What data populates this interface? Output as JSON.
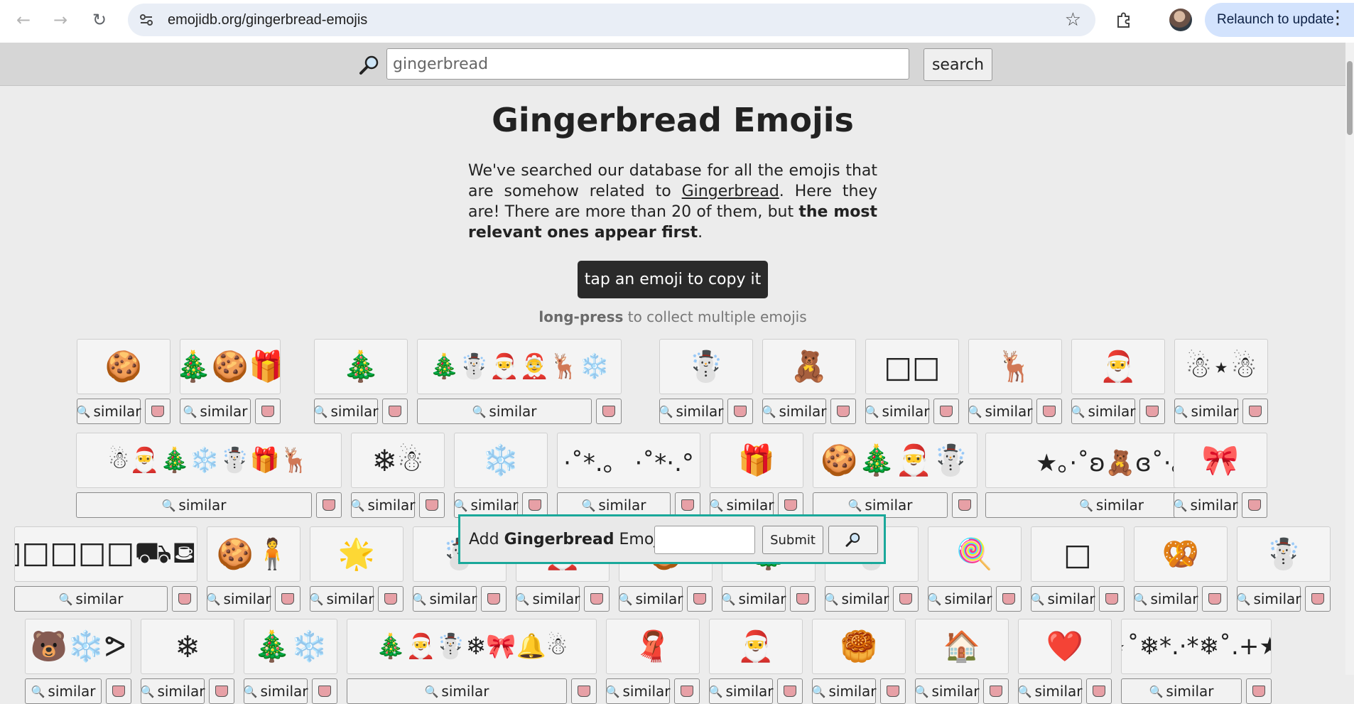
{
  "browser": {
    "back_icon": "←",
    "forward_icon": "→",
    "reload_icon": "↻",
    "url": "emojidb.org/gingerbread-emojis",
    "bookmark_icon": "☆",
    "extensions_icon": "⧉",
    "relaunch_label": "Relaunch to update",
    "menu_icon": "⋮"
  },
  "search": {
    "query": "gingerbread",
    "button_label": "search"
  },
  "page": {
    "title": "Gingerbread Emojis",
    "intro_pre": "We've searched our database for all the emojis that are somehow related to ",
    "intro_link": "Gingerbread",
    "intro_mid": ". Here they are! There are more than 20 of them, but ",
    "intro_bold": "the most relevant ones appear first",
    "intro_end": ".",
    "copy_hint": "tap an emoji to copy it",
    "long_press_bold": "long-press",
    "long_press_rest": " to collect multiple emojis"
  },
  "card_labels": {
    "similar": "similar",
    "similar_icon": "🔍"
  },
  "emoji_cards": [
    {
      "emoji": "🍪"
    },
    {
      "emoji": "🎄🍪🎁"
    },
    {
      "emoji": "🎄"
    },
    {
      "emoji": "🎄☃️🎅🤶🦌❄️"
    },
    {
      "emoji": "☃️"
    },
    {
      "emoji": "🧸"
    },
    {
      "emoji": "□□"
    },
    {
      "emoji": "🦌"
    },
    {
      "emoji": "🎅"
    },
    {
      "emoji": "☃⋆☃"
    },
    {
      "emoji": "☃🎅🎄❄️☃️🎁🦌"
    },
    {
      "emoji": "❄☃"
    },
    {
      "emoji": "❄️"
    },
    {
      "emoji": "·˚*.。 ·˚*·.°"
    },
    {
      "emoji": "🎁"
    },
    {
      "emoji": "🍪🎄🎅☃️"
    },
    {
      "emoji": "★。·˚ʚ🧸ɞ˚·。★"
    },
    {
      "emoji": "🎀"
    },
    {
      "emoji": "□□□□□⛟⛾⚲"
    },
    {
      "emoji": "🍪🧍"
    },
    {
      "emoji": "🌟"
    },
    {
      "emoji": "☃️"
    },
    {
      "emoji": "🎅"
    },
    {
      "emoji": "🍪"
    },
    {
      "emoji": "🎄"
    },
    {
      "emoji": "☃️"
    },
    {
      "emoji": "🍭"
    },
    {
      "emoji": "□"
    },
    {
      "emoji": "🥨"
    },
    {
      "emoji": "☃️"
    },
    {
      "emoji": "🐻❄️ᕗ"
    },
    {
      "emoji": "❄"
    },
    {
      "emoji": "🎄❄️"
    },
    {
      "emoji": "🎄🎅☃️❄🎀🔔☃"
    },
    {
      "emoji": "🧣"
    },
    {
      "emoji": "🎅"
    },
    {
      "emoji": "🥮"
    },
    {
      "emoji": "🏠"
    },
    {
      "emoji": "❤️"
    },
    {
      "emoji": "⋆˚❄*.·*❄˚.+★"
    }
  ],
  "add_form": {
    "label_pre": "Add ",
    "label_bold": "Gingerbread",
    "label_post": " Emoji:",
    "submit_label": "Submit"
  }
}
